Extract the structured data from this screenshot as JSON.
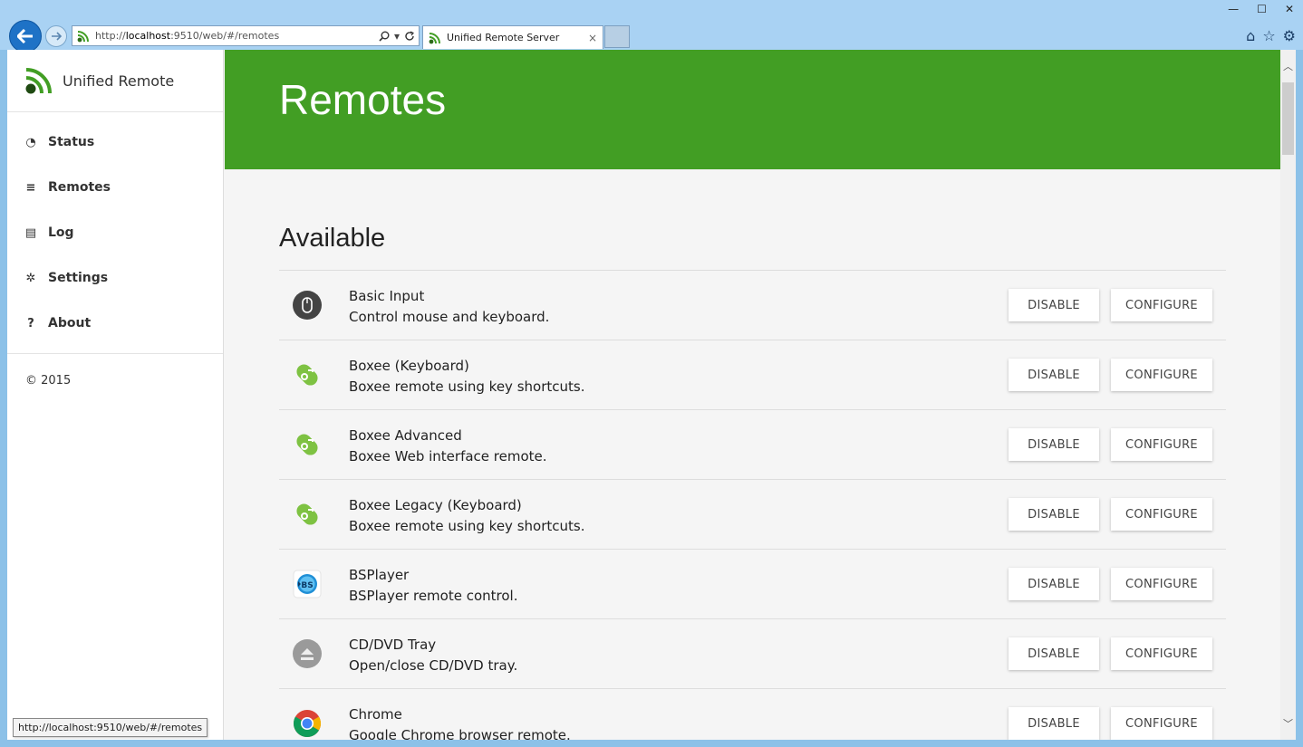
{
  "browser": {
    "url_prefix": "http://",
    "url_host": "localhost",
    "url_rest": ":9510/web/#/remotes",
    "tab_title": "Unified Remote Server",
    "tab_close": "×",
    "win_minimize": "—",
    "win_maximize": "☐",
    "win_close": "✕",
    "status_url": "http://localhost:9510/web/#/remotes"
  },
  "brand": {
    "name": "Unified Remote",
    "color": "#429e24"
  },
  "sidebar": {
    "items": [
      {
        "label": "Status",
        "icon": "dashboard-icon",
        "glyph": "◔"
      },
      {
        "label": "Remotes",
        "icon": "list-icon",
        "glyph": "≡"
      },
      {
        "label": "Log",
        "icon": "file-icon",
        "glyph": "▤"
      },
      {
        "label": "Settings",
        "icon": "gear-icon",
        "glyph": "✲"
      },
      {
        "label": "About",
        "icon": "question-circle-icon",
        "glyph": "?"
      }
    ],
    "footer": "© 2015"
  },
  "page": {
    "title": "Remotes",
    "section_title": "Available"
  },
  "buttons": {
    "disable": "DISABLE",
    "configure": "CONFIGURE"
  },
  "remotes": [
    {
      "name": "Basic Input",
      "desc": "Control mouse and keyboard.",
      "icon": "mouse-icon"
    },
    {
      "name": "Boxee (Keyboard)",
      "desc": "Boxee remote using key shortcuts.",
      "icon": "boxee-icon"
    },
    {
      "name": "Boxee Advanced",
      "desc": "Boxee Web interface remote.",
      "icon": "boxee-icon"
    },
    {
      "name": "Boxee Legacy (Keyboard)",
      "desc": "Boxee remote using key shortcuts.",
      "icon": "boxee-icon"
    },
    {
      "name": "BSPlayer",
      "desc": "BSPlayer remote control.",
      "icon": "bsplayer-icon"
    },
    {
      "name": "CD/DVD Tray",
      "desc": "Open/close CD/DVD tray.",
      "icon": "eject-icon"
    },
    {
      "name": "Chrome",
      "desc": "Google Chrome browser remote.",
      "icon": "chrome-icon"
    }
  ]
}
